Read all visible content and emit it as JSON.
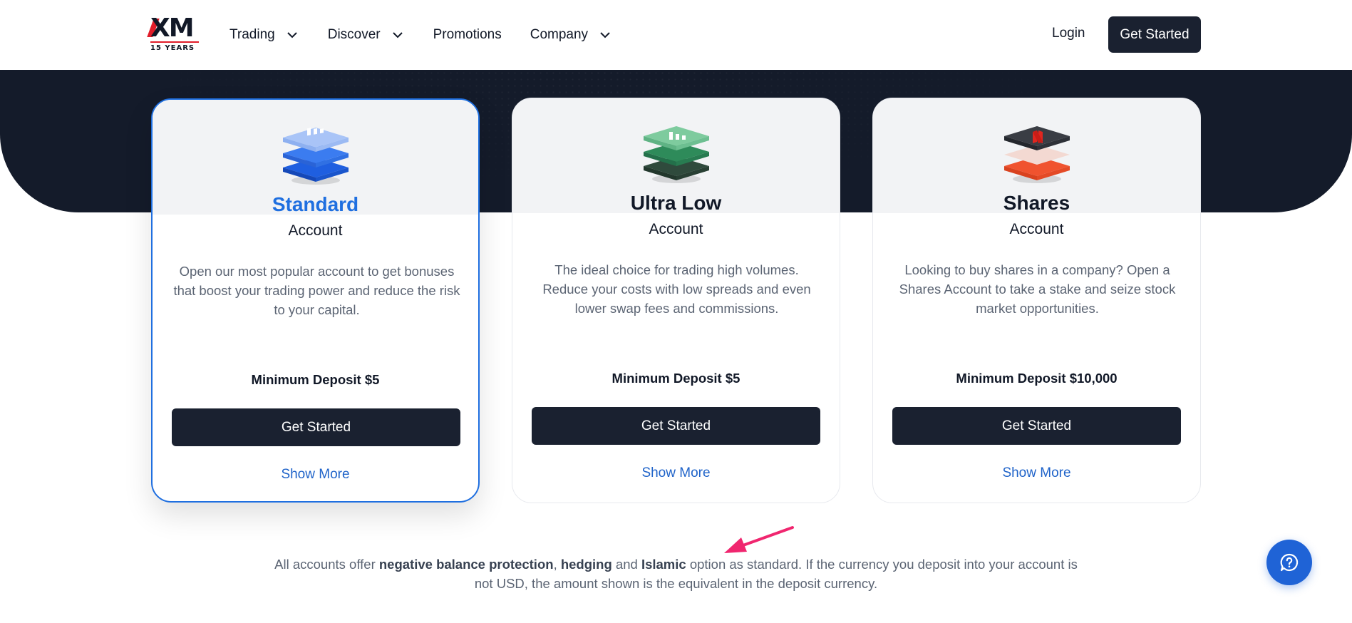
{
  "header": {
    "logo_text": "XM",
    "logo_sub": "15 YEARS",
    "nav": [
      {
        "label": "Trading",
        "has_dropdown": true
      },
      {
        "label": "Discover",
        "has_dropdown": true
      },
      {
        "label": "Promotions",
        "has_dropdown": false
      },
      {
        "label": "Company",
        "has_dropdown": true
      }
    ],
    "login_label": "Login",
    "get_started_label": "Get Started"
  },
  "cards": [
    {
      "title": "Standard",
      "subtitle": "Account",
      "description": "Open our most popular account to get bonuses that boost your trading power and reduce the risk to your capital.",
      "deposit": "Minimum Deposit $5",
      "cta": "Get Started",
      "more": "Show More",
      "icon": "stack-blue-icon",
      "selected": true
    },
    {
      "title": "Ultra Low",
      "subtitle": "Account",
      "description": "The ideal choice for trading high volumes. Reduce your costs with low spreads and even lower swap fees and commissions.",
      "deposit": "Minimum Deposit $5",
      "cta": "Get Started",
      "more": "Show More",
      "icon": "stack-green-icon",
      "selected": false
    },
    {
      "title": "Shares",
      "subtitle": "Account",
      "description": "Looking to buy shares in a company? Open a Shares Account to take a stake and seize stock market opportunities.",
      "deposit": "Minimum Deposit $10,000",
      "cta": "Get Started",
      "more": "Show More",
      "icon": "stack-red-icon",
      "selected": false
    }
  ],
  "note": {
    "part1": "All accounts offer ",
    "bold1": "negative balance protection",
    "sep1": ", ",
    "bold2": "hedging",
    "sep2": " and ",
    "bold3": "Islamic",
    "part2": " option as standard. If the currency you deposit into your account is not USD, the amount shown is the equivalent in the deposit currency."
  },
  "colors": {
    "dark": "#1a2130",
    "accent": "#1f6fe0",
    "link": "#1f63c9",
    "arrow": "#f0266f",
    "chat": "#1f63d6"
  },
  "chat_icon": "chat-help-icon"
}
